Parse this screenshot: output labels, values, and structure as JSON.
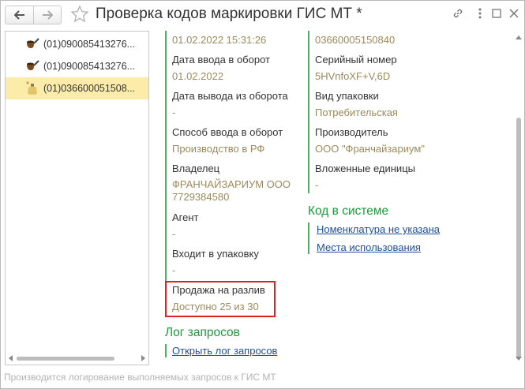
{
  "window": {
    "title": "Проверка кодов маркировки ГИС МТ *"
  },
  "list": {
    "items": [
      {
        "text": "(01)090085413276...",
        "icon": "pipe-icon",
        "selected": false
      },
      {
        "text": "(01)090085413276...",
        "icon": "pipe-icon",
        "selected": false
      },
      {
        "text": "(01)036600051508...",
        "icon": "perfume-icon",
        "selected": true
      }
    ]
  },
  "left_column": {
    "top_value": "01.02.2022 15:31:26",
    "fields": [
      {
        "label": "Дата ввода в оборот",
        "value": "01.02.2022"
      },
      {
        "label": "Дата вывода из оборота",
        "value": "-"
      },
      {
        "label": "Способ ввода в оборот",
        "value": "Производство в РФ"
      },
      {
        "label": "Владелец",
        "value": "ФРАНЧАЙЗАРИУМ ООО",
        "value2": "7729384580"
      },
      {
        "label": "Агент",
        "value": "-"
      },
      {
        "label": "Входит в упаковку",
        "value": "-"
      },
      {
        "label": "Продажа на разлив",
        "value": "Доступно 25 из 30"
      }
    ]
  },
  "right_column": {
    "top_value": "03660005150840",
    "fields": [
      {
        "label": "Серийный номер",
        "value": "5HVnfoXF+V,6D"
      },
      {
        "label": "Вид упаковки",
        "value": "Потребительская"
      },
      {
        "label": "Производитель",
        "value": "ООО \"Франчайзариум\""
      },
      {
        "label": "Вложенные единицы",
        "value": "-"
      }
    ]
  },
  "code_section": {
    "title": "Код в системе",
    "links": [
      "Номенклатура не указана",
      "Места использования"
    ]
  },
  "log_section": {
    "title": "Лог запросов",
    "link": "Открыть лог запросов"
  },
  "status_bar": {
    "text": "Производится логирование выполняемых запросов к ГИС МТ"
  },
  "colors": {
    "accent_green": "#1a9b3c",
    "value_text": "#9a8a5c",
    "link": "#1d4f9c",
    "selected_row": "#fbeca9",
    "highlight": "#e02020"
  }
}
